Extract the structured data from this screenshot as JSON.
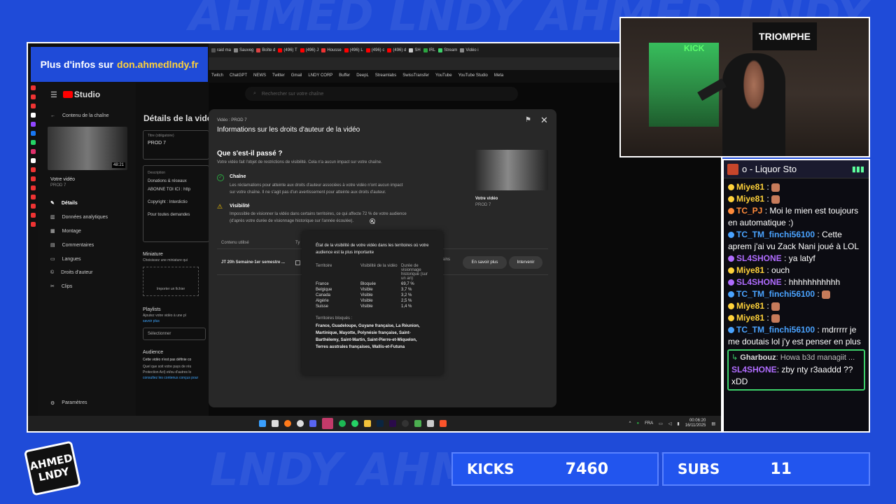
{
  "overlay": {
    "banner_prefix": "Plus d'infos sur",
    "banner_site": "don.ahmedlndy.fr",
    "logo_line1": "AHMED",
    "logo_line2": "LNDY",
    "kicks_label": "KICKS",
    "kicks_value": "7460",
    "subs_label": "SUBS",
    "subs_value": "11"
  },
  "browser": {
    "tabs": [
      "raid ma",
      "Sauveg",
      "Boîte d",
      "(496) T",
      "(496) J",
      "Housse",
      "(496) L",
      "(496) c",
      "(496) d",
      "SH",
      "IRL",
      "Stream",
      "Vidéo i"
    ],
    "bookmarks": [
      "Twitch",
      "ChatGPT",
      "NEWS",
      "Twitter",
      "Gmail",
      "LNDY CORP",
      "Buffer",
      "DeepL",
      "Streamlabs",
      "SwissTransfer",
      "YouTube",
      "YouTube Studio",
      "Meta"
    ]
  },
  "studio": {
    "logo": "Studio",
    "search_placeholder": "Rechercher sur votre chaîne",
    "back_label": "Contenu de la chaîne",
    "thumb_duration": "48:21",
    "video_label": "Votre vidéo",
    "video_title": "PROD 7",
    "nav": [
      "Détails",
      "Données analytiques",
      "Montage",
      "Commentaires",
      "Langues",
      "Droits d'auteur",
      "Clips"
    ],
    "settings": "Paramètres",
    "page_title": "Détails de la vidéo",
    "title_field_label": "Titre (obligatoire)",
    "title_field_value": "PROD 7",
    "desc_label": "Description",
    "desc_line1": "Donations & réseaux",
    "desc_line2": "ABONNE TOI ICI : http",
    "desc_line3": "Copyright : Interdictio",
    "desc_line4": "Pour toutes demandes",
    "miniature_label": "Miniature",
    "miniature_hint": "Choisissez une miniature qui",
    "import_label": "Importer un fichier",
    "playlists_label": "Playlists",
    "playlists_hint": "Ajoutez votre vidéo à une pl",
    "playlists_more": "savoir plus",
    "select_label": "Sélectionner",
    "audience_label": "Audience",
    "audience_line1": "Cette vidéo n'est pas définie co",
    "audience_line2": "Quel que soit votre pays de rés",
    "audience_line3": "Protection Act) et/ou d'autres lo",
    "audience_line4": "consultez les contenus conçus pour"
  },
  "dialog": {
    "video_prefix": "Vidéo : PROD 7",
    "title": "Informations sur les droits d'auteur de la vidéo",
    "what_title": "Que s'est-il passé ?",
    "what_desc": "Votre vidéo fait l'objet de restrictions de visibilité. Cela n'a aucun impact sur votre chaîne.",
    "chaine_title": "Chaîne",
    "chaine_desc1": "Les réclamations pour atteinte aux droits d'auteur associées à votre vidéo n'ont aucun impact",
    "chaine_desc2": "sur votre chaîne. Il ne s'agit pas d'un avertissement pour atteinte aux droits d'auteur.",
    "vis_title": "Visibilité",
    "vis_desc1": "Impossible de visionner la vidéo dans certains territoires, ce qui affecte 72 % de votre audience",
    "vis_desc2": "(d'après votre durée de visionnage historique sur l'année écoulée).",
    "thumb_video_label": "Votre vidéo",
    "thumb_video_title": "PROD 7",
    "col_content": "Contenu utilisé",
    "col_ty": "Ty",
    "row_content": "JT 20h Semaine-1er semestre ...",
    "row_trail": "ains",
    "btn_learn": "En savoir plus",
    "btn_act": "Intervenir"
  },
  "tooltip": {
    "title": "État de la visibilité de votre vidéo dans les territoires où votre audience est la plus importante",
    "headers": [
      "Territoire",
      "Visibilité de la vidéo",
      "Durée de visionnage historique (sur un an)"
    ],
    "rows": [
      [
        "France",
        "Bloquée",
        "69,7 %"
      ],
      [
        "Belgique",
        "Visible",
        "3,7 %"
      ],
      [
        "Canada",
        "Visible",
        "3,2 %"
      ],
      [
        "Algérie",
        "Visible",
        "2,5 %"
      ],
      [
        "Suisse",
        "Visible",
        "1,4 %"
      ]
    ],
    "blocked_label": "Territoires bloqués :",
    "blocked_list": "France, Guadeloupe, Guyane française, La Réunion, Martinique, Mayotte, Polynésie française, Saint-Barthélemy, Saint-Martin, Saint-Pierre-et-Miquelon, Terres australes françaises, Wallis-et-Futuna"
  },
  "taskbar": {
    "lang": "FRA",
    "time": "00:06:20",
    "date": "16/11/2025"
  },
  "webcam": {
    "poster": "TRIOMPHE",
    "neon": "KICK"
  },
  "chat": {
    "header": "o - Liquor Sto",
    "messages": [
      {
        "user": "Miye81",
        "color": "#ffd23a",
        "text": ""
      },
      {
        "user": "Miye81",
        "color": "#ffd23a",
        "text": ""
      },
      {
        "user": "TC_PJ",
        "color": "#ff8a3a",
        "text": "Moi le mien est toujours en automatique :)"
      },
      {
        "user": "TC_TM_finchi56100",
        "color": "#4aa3ff",
        "text": "Cette aprem j'ai vu Zack Nani joué à LOL"
      },
      {
        "user": "SL4SHONE",
        "color": "#b06cff",
        "text": "ya latyf"
      },
      {
        "user": "Miye81",
        "color": "#ffd23a",
        "text": "ouch"
      },
      {
        "user": "SL4SHONE",
        "color": "#b06cff",
        "text": "hhhhhhhhhhh"
      },
      {
        "user": "TC_TM_finchi56100",
        "color": "#4aa3ff",
        "text": ""
      },
      {
        "user": "Miye81",
        "color": "#ffd23a",
        "text": ""
      },
      {
        "user": "Miye81",
        "color": "#ffd23a",
        "text": ""
      },
      {
        "user": "TC_TM_finchi56100",
        "color": "#4aa3ff",
        "text": "mdrrrrr je me doutais lol j'y est penser en plus"
      }
    ],
    "reply_user": "Gharbouz",
    "reply_text": "Howa b3d managiit ...",
    "reply_msg_user": "SL4SHONE",
    "reply_msg_text": "zby nty r3aaddd ?? xDD"
  }
}
